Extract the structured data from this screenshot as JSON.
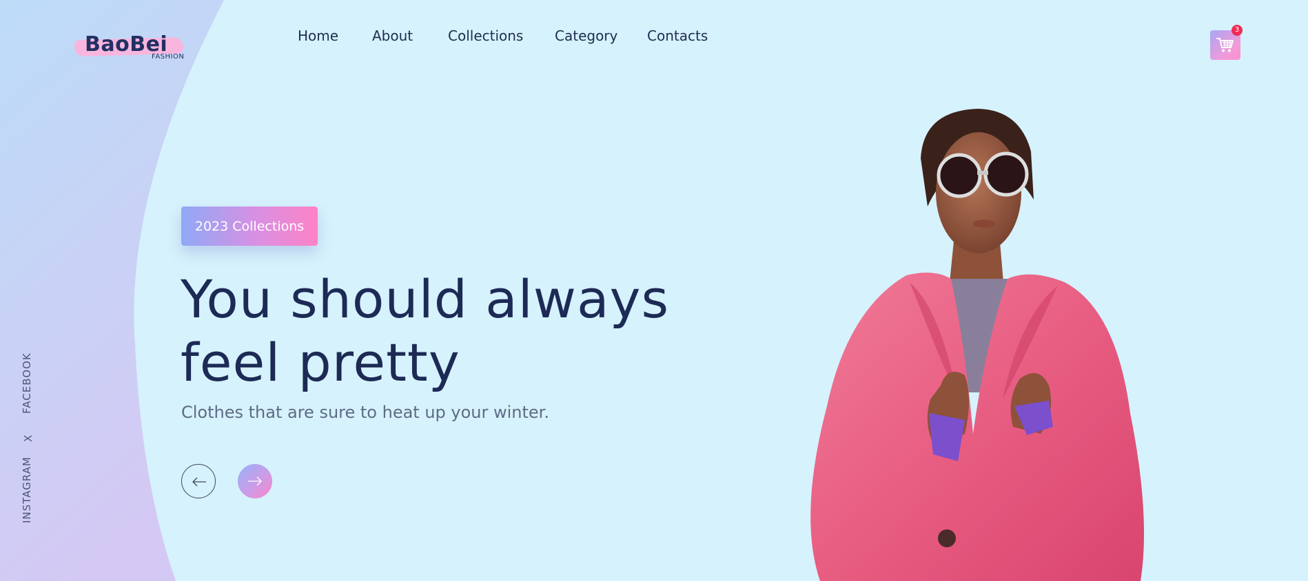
{
  "brand": {
    "name": "BaoBei",
    "tagline": "FASHION"
  },
  "nav": {
    "items": [
      "Home",
      "About",
      "Collections",
      "Category",
      "Contacts"
    ]
  },
  "cart": {
    "count": "3",
    "icon": "cart-icon"
  },
  "hero": {
    "badge": "2023 Collections",
    "headline_line1": "You should always",
    "headline_line2": "feel pretty",
    "subtitle": "Clothes that are sure to heat up your winter."
  },
  "controls": {
    "prev_icon": "arrow-left-icon",
    "next_icon": "arrow-right-icon"
  },
  "social": {
    "facebook": "FACEBOOK",
    "separator": "X",
    "instagram": "INSTAGRAM"
  },
  "colors": {
    "background": "#d6f2fc",
    "text": "#1c2a55",
    "accent_pink": "#fe82c7",
    "accent_blue": "#8fa9f6",
    "badge_red": "#ee2d57"
  }
}
